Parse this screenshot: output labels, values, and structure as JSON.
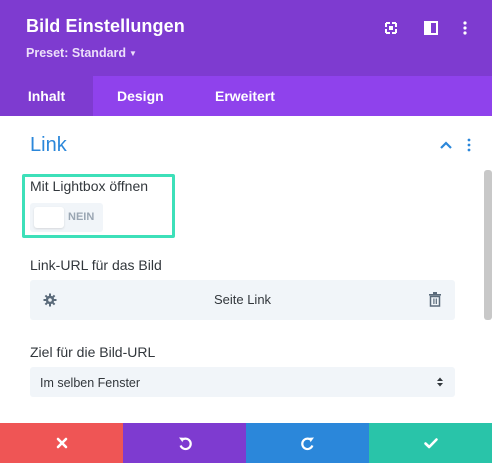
{
  "header": {
    "title": "Bild Einstellungen",
    "preset_label": "Preset: Standard",
    "icons": [
      "fullscreen-icon",
      "split-view-icon",
      "more-options-icon"
    ]
  },
  "tabs": [
    {
      "label": "Inhalt",
      "active": true
    },
    {
      "label": "Design",
      "active": false
    },
    {
      "label": "Erweitert",
      "active": false
    }
  ],
  "section": {
    "title": "Link",
    "expanded": true
  },
  "lightbox": {
    "label": "Mit Lightbox öffnen",
    "toggle_value": "NEIN",
    "enabled": false
  },
  "link_url": {
    "label": "Link-URL für das Bild",
    "value": "Seite Link"
  },
  "target": {
    "label": "Ziel für die Bild-URL",
    "selected": "Im selben Fenster"
  },
  "footer": {
    "buttons": [
      {
        "name": "discard",
        "icon": "close-icon",
        "color": "#ef5555"
      },
      {
        "name": "undo",
        "icon": "undo-icon",
        "color": "#7e3bd0"
      },
      {
        "name": "redo",
        "icon": "redo-icon",
        "color": "#2b87da"
      },
      {
        "name": "save",
        "icon": "check-icon",
        "color": "#29c4a9"
      }
    ]
  },
  "colors": {
    "header_bg": "#7e3bd0",
    "tab_bar_bg": "#8f42ec",
    "accent_blue": "#2b87da",
    "highlight_border": "#3de0b9"
  }
}
